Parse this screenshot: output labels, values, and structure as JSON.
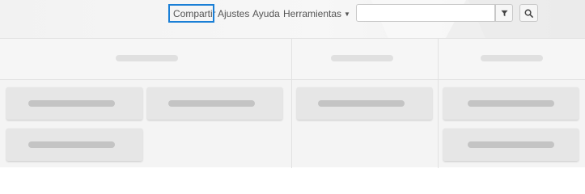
{
  "nav": {
    "share_label": "Compartir",
    "settings_label": "Ajustes",
    "help_label": "Ayuda",
    "tools_label": "Herramientas",
    "tools_caret_icon": "caret-down-icon"
  },
  "search": {
    "value": "",
    "placeholder": "",
    "filter_icon": "filter-icon",
    "search_icon": "magnifier-icon"
  },
  "colors": {
    "highlight": "#1a7fd6",
    "nav_text": "#555555",
    "card": "#e6e6e6",
    "placeholder": "#c4c4c4"
  },
  "board": {
    "columns": [
      {
        "header": "",
        "cards": [
          "",
          "",
          ""
        ]
      },
      {
        "header": "",
        "cards": [
          ""
        ]
      },
      {
        "header": "",
        "cards": [
          "",
          ""
        ]
      }
    ]
  }
}
